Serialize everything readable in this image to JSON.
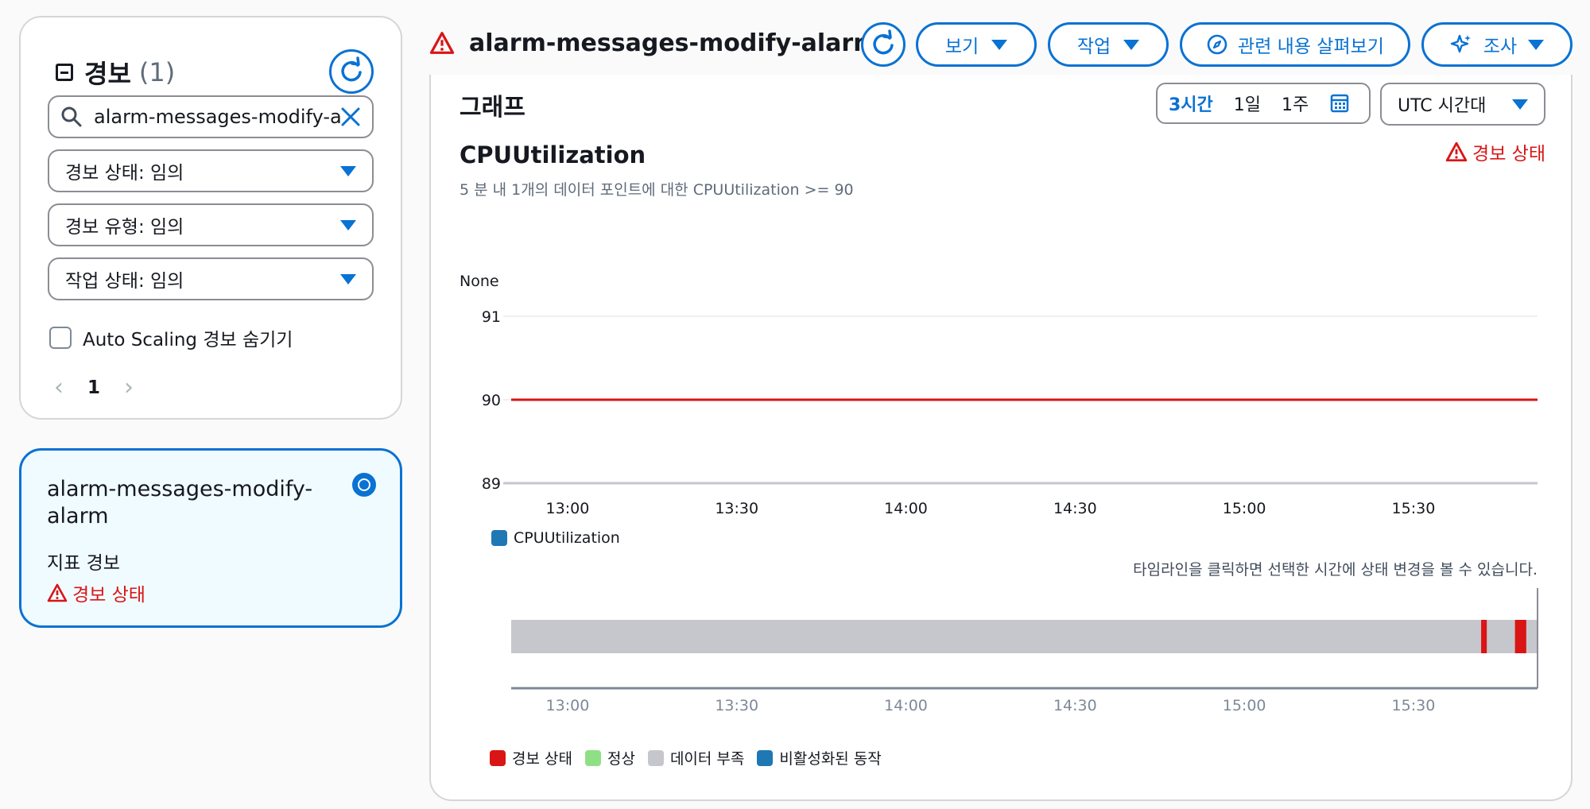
{
  "filters": {
    "title": "경보",
    "count": "(1)",
    "search_value": "alarm-messages-modify-a",
    "alarm_state": "경보 상태: 임의",
    "alarm_type": "경보 유형: 임의",
    "action_state": "작업 상태: 임의",
    "hide_autoscaling": "Auto Scaling 경보 숨기기",
    "page": "1"
  },
  "alarm_card": {
    "name": "alarm-messages-modify-alarm",
    "type": "지표 경보",
    "state": "경보 상태"
  },
  "header": {
    "title": "alarm-messages-modify-alarm",
    "view_label": "보기",
    "actions_label": "작업",
    "explore_label": "관련 내용 살펴보기",
    "investigate_label": "조사"
  },
  "graph": {
    "heading": "그래프",
    "range_options": [
      "3시간",
      "1일",
      "1주"
    ],
    "timezone": "UTC 시간대",
    "metric": "CPUUtilization",
    "state_tag": "경보 상태",
    "description": "5 분 내 1개의 데이터 포인트에 대한 CPUUtilization >= 90",
    "legend": "CPUUtilization",
    "timeline_hint": "타임라인을 클릭하면 선택한 시간에 상태 변경을 볼 수 있습니다.",
    "timeline_legend": [
      "경보 상태",
      "정상",
      "데이터 부족",
      "비활성화된 동작"
    ]
  },
  "colors": {
    "accent": "#0972d3",
    "alarm": "#d91515",
    "ok": "#8fe084",
    "insufficient": "#c6c6cd",
    "disabled": "#1f77b4"
  },
  "chart_data": [
    {
      "type": "line",
      "title": "CPUUtilization",
      "ylabel": "None",
      "xlabel": "",
      "y_ticks": [
        89,
        90,
        91
      ],
      "ylim": [
        89,
        91
      ],
      "x_ticks": [
        "13:00",
        "13:30",
        "14:00",
        "14:30",
        "15:00",
        "15:30"
      ],
      "xlim": [
        "12:50",
        "15:52"
      ],
      "threshold": 90,
      "series": [
        {
          "name": "CPUUtilization",
          "values": []
        }
      ],
      "grid": true,
      "legend": "bottom-left"
    },
    {
      "type": "timeline",
      "x_ticks": [
        "13:00",
        "13:30",
        "14:00",
        "14:30",
        "15:00",
        "15:30"
      ],
      "xlim": [
        "12:50",
        "15:52"
      ],
      "segments": [
        {
          "state": "데이터 부족",
          "start": "12:50",
          "end": "15:52"
        },
        {
          "state": "경보 상태",
          "start": "15:42",
          "end": "15:43"
        },
        {
          "state": "경보 상태",
          "start": "15:48",
          "end": "15:50"
        }
      ]
    }
  ]
}
